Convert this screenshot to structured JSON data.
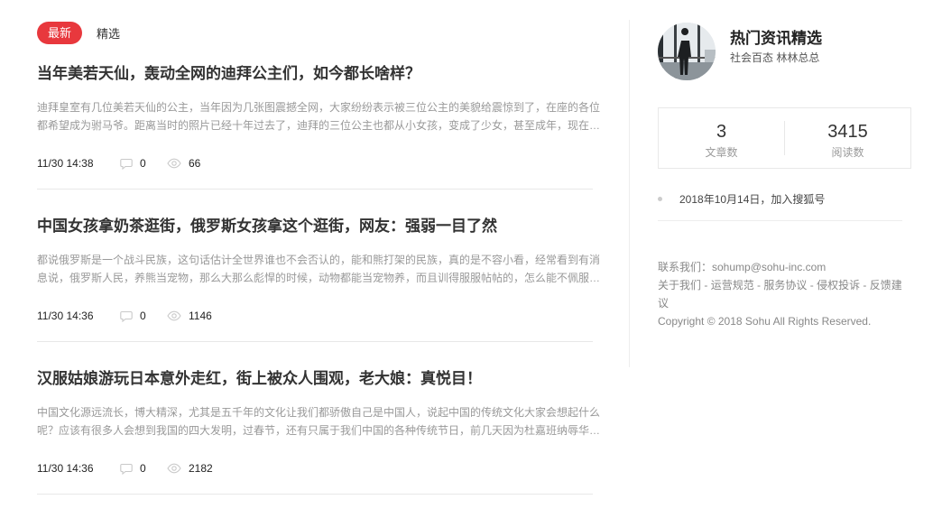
{
  "tabs": {
    "latest": "最新",
    "featured": "精选"
  },
  "articles": [
    {
      "title": "当年美若天仙，轰动全网的迪拜公主们，如今都长啥样？",
      "summary": "迪拜皇室有几位美若天仙的公主，当年因为几张图震撼全网，大家纷纷表示被三位公主的美貌给震惊到了，在座的各位都希望成为驸马爷。距离当时的照片已经十年过去了，迪拜的三位公主也都从小女孩，变成了少女，甚至成年，现在…",
      "time": "11/30 14:38",
      "comments": "0",
      "reads": "66"
    },
    {
      "title": "中国女孩拿奶茶逛街，俄罗斯女孩拿这个逛街，网友：强弱一目了然",
      "summary": "都说俄罗斯是一个战斗民族，这句话估计全世界谁也不会否认的，能和熊打架的民族，真的是不容小看，经常看到有消息说，俄罗斯人民，养熊当宠物，那么大那么彪悍的时候，动物都能当宠物养，而且训得服服帖帖的，怎么能不佩服…",
      "time": "11/30 14:36",
      "comments": "0",
      "reads": "1146"
    },
    {
      "title": "汉服姑娘游玩日本意外走红，街上被众人围观，老大娘：真悦目！",
      "summary": "中国文化源远流长，博大精深，尤其是五千年的文化让我们都骄傲自己是中国人，说起中国的传统文化大家会想起什么呢？应该有很多人会想到我国的四大发明，过春节，还有只属于我们中国的各种传统节日，前几天因为杜嘉班纳辱华…",
      "time": "11/30 14:36",
      "comments": "0",
      "reads": "2182"
    }
  ],
  "profile": {
    "name": "热门资讯精选",
    "desc": "社会百态 林林总总"
  },
  "stats": {
    "articles_num": "3",
    "articles_label": "文章数",
    "reads_num": "3415",
    "reads_label": "阅读数"
  },
  "joined": "2018年10月14日，加入搜狐号",
  "footer": {
    "contact": "联系我们：sohump@sohu-inc.com",
    "about": "关于我们",
    "rules": "运营规范",
    "agreement": "服务协议",
    "complaint": "侵权投诉",
    "feedback": "反馈建议",
    "sep": " - ",
    "copyright": "Copyright © 2018 Sohu All Rights Reserved."
  },
  "icons": {
    "comment": "comment-bubble-icon",
    "reads": "eye-icon"
  },
  "colors": {
    "accent": "#e8383d"
  }
}
